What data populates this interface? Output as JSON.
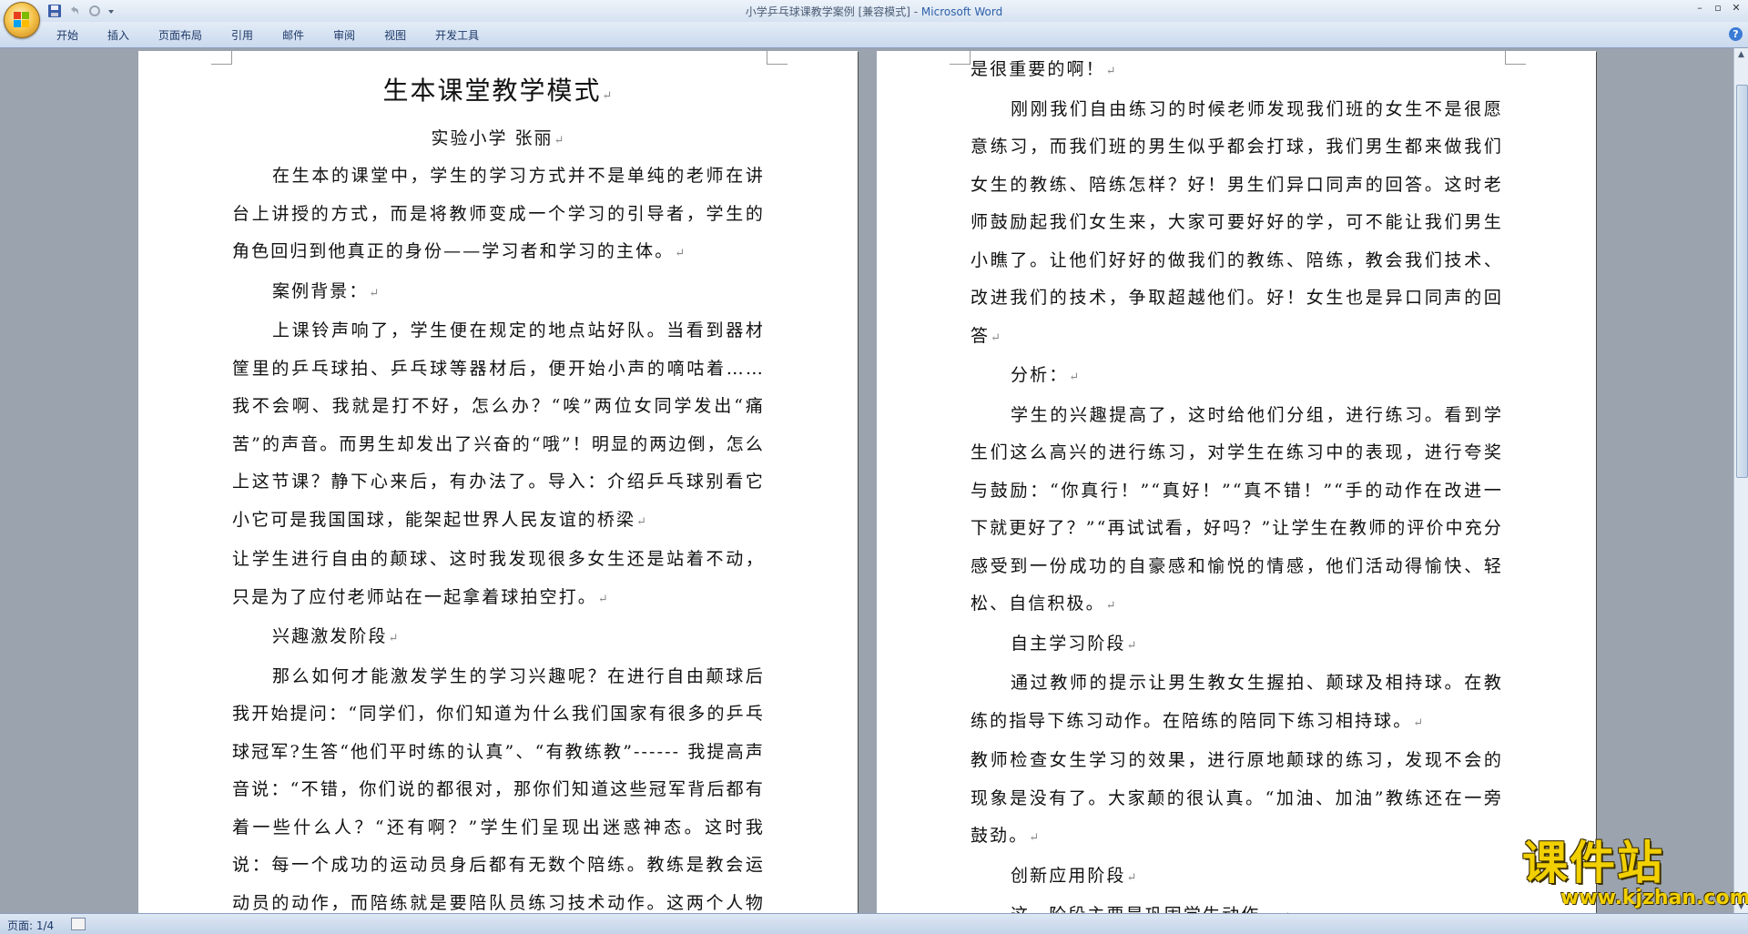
{
  "window": {
    "title": "小学乒乓球课教学案例 [兼容模式] - ",
    "app_name": "Microsoft Word",
    "minimize": "–",
    "restore": "▫",
    "close": "✕"
  },
  "ribbon": {
    "tabs": [
      "开始",
      "插入",
      "页面布局",
      "引用",
      "邮件",
      "审阅",
      "视图",
      "开发工具"
    ],
    "help": "?"
  },
  "document": {
    "title": "生本课堂教学模式",
    "author": "实验小学  张丽",
    "left_paragraphs": [
      {
        "text": "在生本的课堂中，学生的学习方式并不是单纯的老师在讲台上讲授的方式，而是将教师变成一个学习的引导者，学生的角色回归到他真正的身份——学习者和学习的主体。",
        "indent": true
      },
      {
        "text": "案例背景：",
        "indent": true
      },
      {
        "text": "上课铃声响了，学生便在规定的地点站好队。当看到器材筐里的乒乓球拍、乒乓球等器材后，便开始小声的嘀咕着……我不会啊、我就是打不好，怎么办？“唉”两位女同学发出“痛苦”的声音。而男生却发出了兴奋的“哦”！明显的两边倒，怎么上这节课？静下心来后，有办法了。导入：介绍乒乓球别看它小它可是我国国球，能架起世界人民友谊的桥梁",
        "indent": true
      },
      {
        "text": "让学生进行自由的颠球、这时我发现很多女生还是站着不动，只是为了应付老师站在一起拿着球拍空打。",
        "indent": false
      },
      {
        "text": "兴趣激发阶段",
        "indent": true
      },
      {
        "text": "那么如何才能激发学生的学习兴趣呢？在进行自由颠球后我开始提问：“同学们，你们知道为什么我们国家有很多的乒乓球冠军?生答“他们平时练的认真”、“有教练教”------ 我提高声音说：“不错，你们说的都很对，那你们知道这些冠军背后都有着一些什么人？“还有啊？”学生们呈现出迷惑神态。这时我说：每一个成功的运动员身后都有无数个陪练。教练是教会运动员的动作，而陪练就是要陪队员练习技术动作。这两个人物都",
        "indent": true
      }
    ],
    "right_paragraphs": [
      {
        "text": "是很重要的啊！",
        "indent": false
      },
      {
        "text": "刚刚我们自由练习的时候老师发现我们班的女生不是很愿意练习，而我们班的男生似乎都会打球，我们男生都来做我们女生的教练、陪练怎样？好！男生们异口同声的回答。这时老师鼓励起我们女生来，大家可要好好的学，可不能让我们男生小瞧了。让他们好好的做我们的教练、陪练，教会我们技术、改进我们的技术，争取超越他们。好！女生也是异口同声的回答",
        "indent": true
      },
      {
        "text": "分析：",
        "indent": true
      },
      {
        "text": "学生的兴趣提高了，这时给他们分组，进行练习。看到学生们这么高兴的进行练习，对学生在练习中的表现，进行夸奖与鼓励：“你真行！”“真好！”“真不错！”“手的动作在改进一下就更好了？”“再试试看，好吗？”让学生在教师的评价中充分感受到一份成功的自豪感和愉悦的情感，他们活动得愉快、轻松、自信积极。",
        "indent": true
      },
      {
        "text": "自主学习阶段",
        "indent": true
      },
      {
        "text": "通过教师的提示让男生教女生握拍、颠球及相持球。在教练的指导下练习动作。在陪练的陪同下练习相持球。",
        "indent": true
      },
      {
        "text": "教师检查女生学习的效果，进行原地颠球的练习，发现不会的现象是没有了。大家颠的很认真。“加油、加油”教练还在一旁鼓劲。",
        "indent": false
      },
      {
        "text": "创新应用阶段",
        "indent": true
      },
      {
        "text": "这一阶段主要是巩固学生动作。",
        "indent": true
      }
    ]
  },
  "status": {
    "page": "页面: 1/4"
  },
  "watermark": {
    "cn": "课件站",
    "url": "www.kjzhan.com"
  }
}
